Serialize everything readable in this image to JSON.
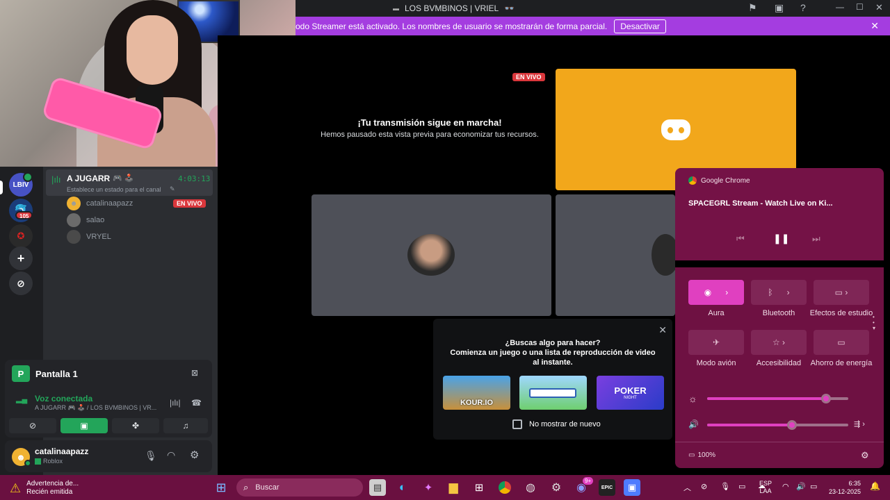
{
  "window": {
    "title": "LOS BVMBINOS | VRIEL",
    "title_emoji": "👓"
  },
  "banner": {
    "message": "odo Streamer está activado. Los nombres de usuario se mostrarán de forma parcial.",
    "button": "Desactivar"
  },
  "servers": {
    "items": [
      {
        "label": "LBIV"
      },
      {
        "label": "",
        "badge": "105"
      },
      {
        "label": ""
      }
    ]
  },
  "channel": {
    "name": "A JUGARR",
    "emojis": "🎮 🕹️",
    "timer": "4:03:13",
    "status_prompt": "Establece un estado para el canal",
    "users": [
      {
        "name": "catalinaapazz",
        "live": "EN VIVO"
      },
      {
        "name": "salao",
        "live": ""
      },
      {
        "name": "VRYEL",
        "live": ""
      }
    ]
  },
  "screen_panel": {
    "title": "Pantalla 1",
    "voice_status": "Voz conectada",
    "voice_channel": "A JUGARR 🎮 🕹️ / LOS BVMBINOS | VR..."
  },
  "user_panel": {
    "username": "catalinaapazz",
    "status": "Roblox"
  },
  "stream": {
    "live_badge": "EN VIVO",
    "paused_title": "¡Tu transmisión sigue en marcha!",
    "paused_sub": "Hemos pausado esta vista previa para economizar tus recursos."
  },
  "activity": {
    "question": "¿Buscas algo para hacer?",
    "subtitle": "Comienza un juego o una lista de reproducción de video al instante.",
    "games": [
      {
        "name": "KOUR.IO"
      },
      {
        "name": ""
      },
      {
        "name": "POKER",
        "sub": "NIGHT"
      }
    ],
    "checkbox_label": "No mostrar de nuevo"
  },
  "media": {
    "app": "Google Chrome",
    "track": "SPACEGRL Stream - Watch Live on Ki..."
  },
  "quick_settings": {
    "tiles": [
      {
        "label": "Aura",
        "icon": "wifi-icon",
        "active": true
      },
      {
        "label": "Bluetooth",
        "icon": "bluetooth-icon",
        "active": false
      },
      {
        "label": "Efectos de estudio",
        "icon": "studio-effects-icon",
        "active": false
      },
      {
        "label": "Modo avión",
        "icon": "airplane-icon",
        "active": false
      },
      {
        "label": "Accesibilidad",
        "icon": "accessibility-icon",
        "active": false
      },
      {
        "label": "Ahorro de energía",
        "icon": "battery-saver-icon",
        "active": false
      }
    ],
    "brightness": 0.84,
    "volume": 0.6,
    "battery": "100%"
  },
  "taskbar": {
    "notification_title": "Advertencia de...",
    "notification_sub": "Recién emitida",
    "search_placeholder": "Buscar",
    "discord_badge": "9+",
    "lang": "ESP",
    "lang_sub": "LAA",
    "time": "6:35",
    "date": "23-12-2025"
  },
  "colors": {
    "accent": "#e040c0",
    "banner": "#a43de0",
    "discord_yellow": "#f2a71b",
    "live_red": "#da373c",
    "voice_green": "#23a55a"
  }
}
